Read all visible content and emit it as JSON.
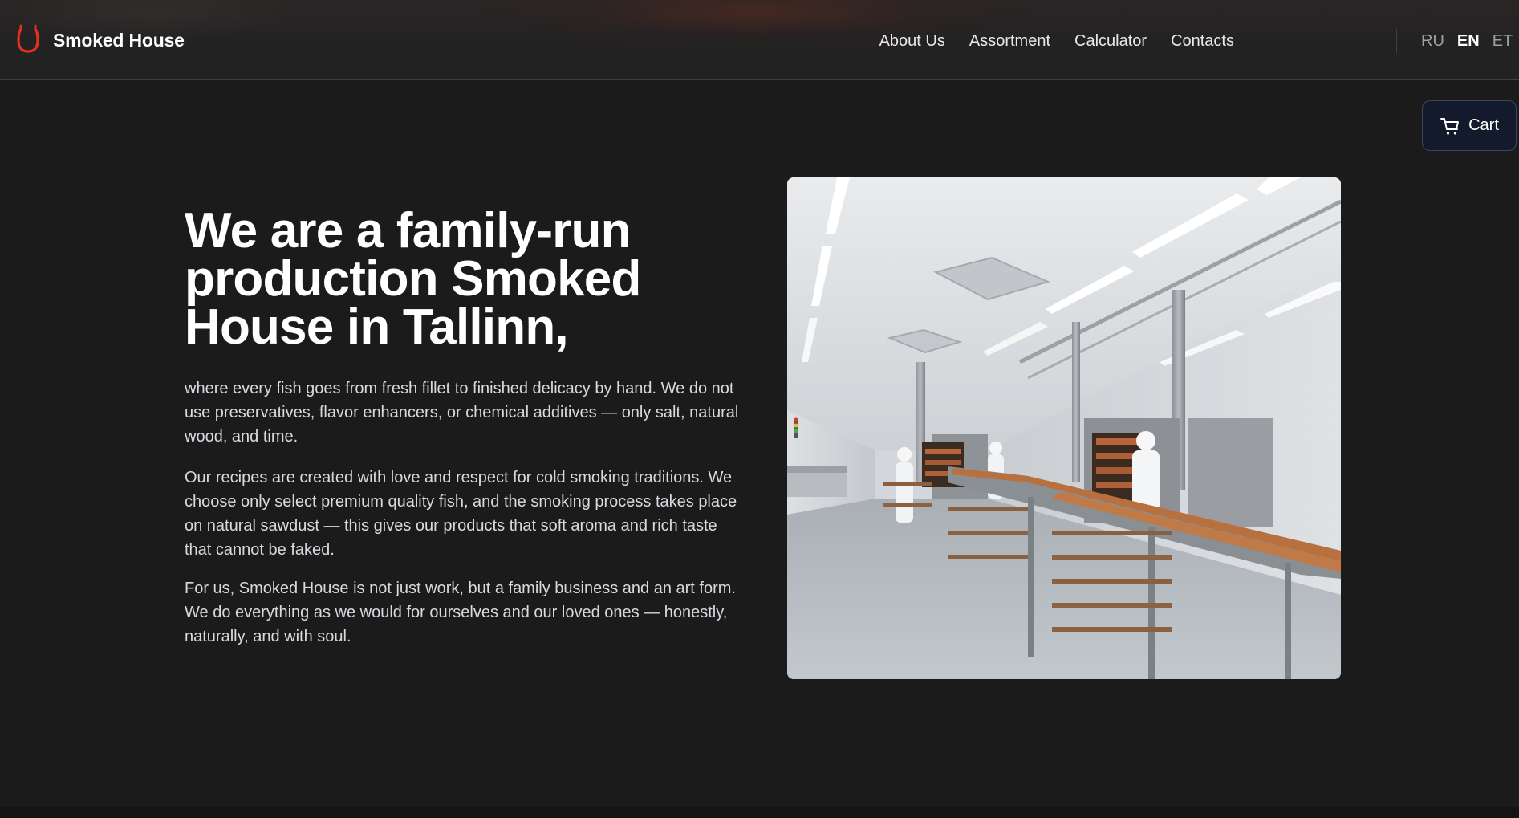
{
  "header": {
    "brand": {
      "name": "Smoked House",
      "logo_icon": "horseshoe-logo-icon",
      "logo_color": "#e0321e"
    },
    "nav": [
      {
        "label": "About Us"
      },
      {
        "label": "Assortment"
      },
      {
        "label": "Calculator"
      },
      {
        "label": "Contacts"
      }
    ],
    "languages": [
      {
        "code": "RU",
        "active": false
      },
      {
        "code": "EN",
        "active": true
      },
      {
        "code": "ET",
        "active": false
      }
    ]
  },
  "cart": {
    "label": "Cart",
    "icon": "cart-icon"
  },
  "main": {
    "headline": "We are a family-run production Smoked House in Tallinn,",
    "paragraphs": [
      "where every fish goes from fresh fillet to finished delicacy by hand. We do not use preservatives, flavor enhancers, or chemical additives — only salt, natural wood, and time.",
      "Our recipes are created with love and respect for cold smoking traditions. We choose only select premium quality fish, and the smoking process takes place on natural sawdust — this gives our products that soft aroma and rich taste that cannot be faked.",
      "For us, Smoked House is not just work, but a family business and an art form. We do everything as we would for ourselves and our loved ones — honestly, naturally, and with soul."
    ]
  },
  "colors": {
    "background": "#1b1b1c",
    "accent": "#e0321e",
    "cart_bg": "#131a2b"
  }
}
